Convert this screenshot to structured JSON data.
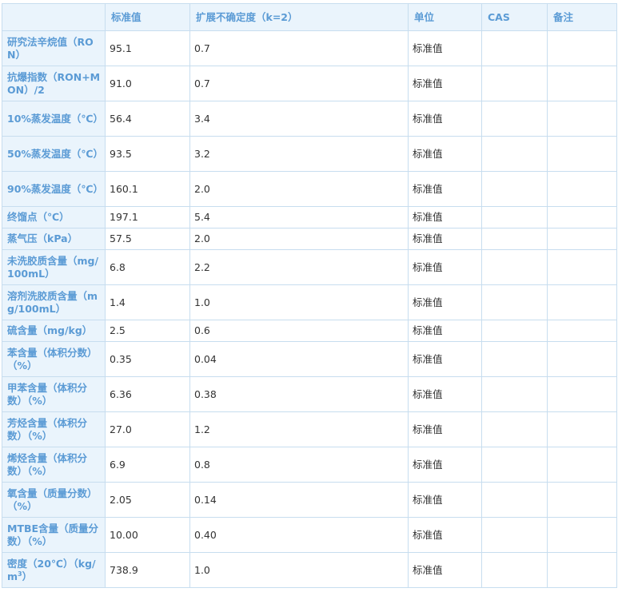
{
  "columns": [
    "",
    "标准值",
    "扩展不确定度（k=2）",
    "单位",
    "CAS",
    "备注"
  ],
  "rows": [
    {
      "name": "研究法辛烷值（RON）",
      "value": "95.1",
      "uncertainty": "0.7",
      "unit": "标准值",
      "cas": "",
      "note": ""
    },
    {
      "name": "抗爆指数（RON+MON）/2",
      "value": "91.0",
      "uncertainty": "0.7",
      "unit": "标准值",
      "cas": "",
      "note": ""
    },
    {
      "name": "10%蒸发温度（℃）",
      "value": "56.4",
      "uncertainty": "3.4",
      "unit": "标准值",
      "cas": "",
      "note": ""
    },
    {
      "name": "50%蒸发温度（℃）",
      "value": "93.5",
      "uncertainty": "3.2",
      "unit": "标准值",
      "cas": "",
      "note": ""
    },
    {
      "name": "90%蒸发温度（℃）",
      "value": "160.1",
      "uncertainty": "2.0",
      "unit": "标准值",
      "cas": "",
      "note": ""
    },
    {
      "name": "终馏点（℃）",
      "value": "197.1",
      "uncertainty": "5.4",
      "unit": "标准值",
      "cas": "",
      "note": ""
    },
    {
      "name": "蒸气压（kPa）",
      "value": "57.5",
      "uncertainty": "2.0",
      "unit": "标准值",
      "cas": "",
      "note": ""
    },
    {
      "name": "未洗胶质含量（mg/100mL）",
      "value": "6.8",
      "uncertainty": "2.2",
      "unit": "标准值",
      "cas": "",
      "note": ""
    },
    {
      "name": "溶剂洗胶质含量（mg/100mL）",
      "value": "1.4",
      "uncertainty": "1.0",
      "unit": "标准值",
      "cas": "",
      "note": ""
    },
    {
      "name": "硫含量（mg/kg）",
      "value": "2.5",
      "uncertainty": "0.6",
      "unit": "标准值",
      "cas": "",
      "note": ""
    },
    {
      "name": "苯含量（体积分数）（%）",
      "value": "0.35",
      "uncertainty": "0.04",
      "unit": "标准值",
      "cas": "",
      "note": ""
    },
    {
      "name": "甲苯含量（体积分数）（%）",
      "value": "6.36",
      "uncertainty": "0.38",
      "unit": "标准值",
      "cas": "",
      "note": ""
    },
    {
      "name": "芳烃含量（体积分数）（%）",
      "value": "27.0",
      "uncertainty": "1.2",
      "unit": "标准值",
      "cas": "",
      "note": ""
    },
    {
      "name": "烯烃含量（体积分数）（%）",
      "value": "6.9",
      "uncertainty": "0.8",
      "unit": "标准值",
      "cas": "",
      "note": ""
    },
    {
      "name": "氧含量（质量分数）（%）",
      "value": "2.05",
      "uncertainty": "0.14",
      "unit": "标准值",
      "cas": "",
      "note": ""
    },
    {
      "name": "MTBE含量（质量分数）（%）",
      "value": "10.00",
      "uncertainty": "0.40",
      "unit": "标准值",
      "cas": "",
      "note": ""
    },
    {
      "name": "密度（20℃）（kg/m3）",
      "value": "738.9",
      "uncertainty": "1.0",
      "unit": "标准值",
      "cas": "",
      "note": ""
    }
  ],
  "colors": {
    "header_bg": "#eaf4fc",
    "header_text": "#5b9bd5",
    "border": "#c7ddef",
    "body_text": "#333333"
  }
}
